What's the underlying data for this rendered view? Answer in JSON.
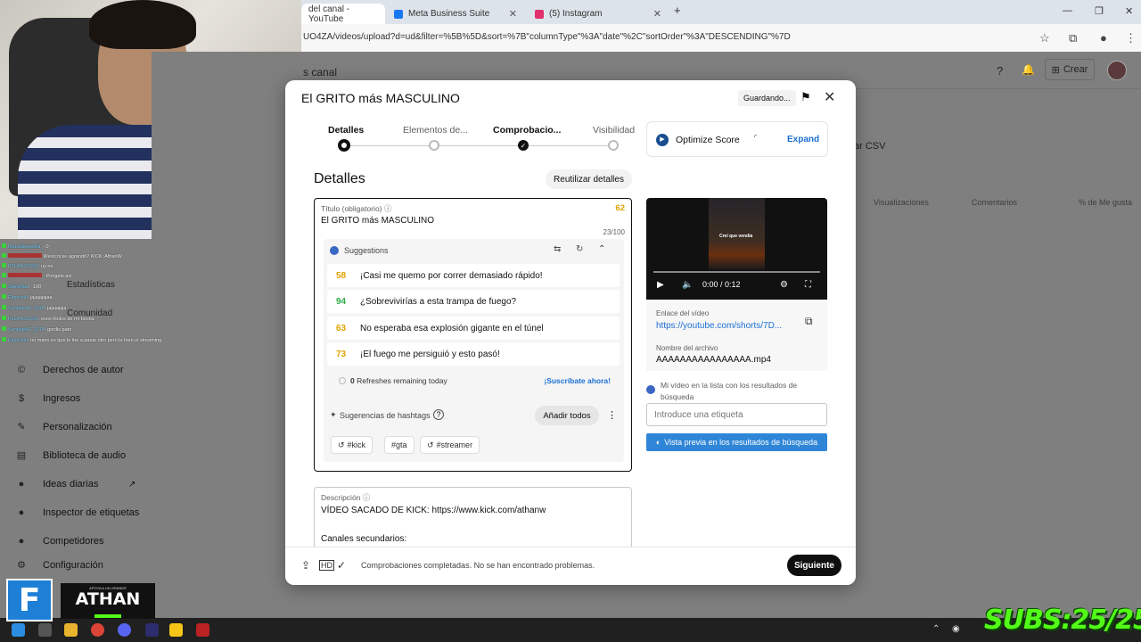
{
  "browser": {
    "tabs": [
      {
        "title": "del canal - YouTube",
        "color": "#ff0000"
      },
      {
        "title": "Meta Business Suite",
        "color": "#1877f2"
      },
      {
        "title": "(5) Instagram",
        "color": "#e1306c"
      }
    ],
    "url": "UO4ZA/videos/upload?d=ud&filter=%5B%5D&sort=%7B\"columnType\"%3A\"date\"%2C\"sortOrder\"%3A\"DESCENDING\"%7D"
  },
  "studio": {
    "title": "s canal",
    "crear": "Crear",
    "csv": "ar CSV",
    "columns": [
      "Visualizaciones",
      "Comentarios",
      "% de Me gusta"
    ],
    "sidebar": [
      {
        "icon": "©",
        "label": "Derechos de autor"
      },
      {
        "icon": "$",
        "label": "Ingresos"
      },
      {
        "icon": "✎",
        "label": "Personalización"
      },
      {
        "icon": "▤",
        "label": "Biblioteca de audio"
      },
      {
        "icon": "●",
        "label": "Ideas diarias"
      },
      {
        "icon": "●",
        "label": "Inspector de etiquetas"
      },
      {
        "icon": "●",
        "label": "Competidores"
      },
      {
        "icon": "⚙",
        "label": "Configuración"
      }
    ],
    "hidden_items": [
      "Estadísticas",
      "Comunidad"
    ]
  },
  "chat": [
    {
      "user": "Mariaalejandra_",
      "msg": ": 0"
    },
    {
      "user": "",
      "msg": "Westcol se agrandó? KICK: AthanW"
    },
    {
      "user": "P3LANGOSO",
      "msg": ": uy no"
    },
    {
      "user": "",
      "msg": ": Pongale así"
    },
    {
      "user": "SitesMad",
      "msg": ": -100"
    },
    {
      "user": "Elgordo6",
      "msg": ": jajajajajaa"
    },
    {
      "user": "SantiagoR_1974",
      "msg": ": jajajajaja"
    },
    {
      "user": "P3LANGOSO",
      "msg": ": esos títulos de mr bestia"
    },
    {
      "user": "SantiagoR_1974",
      "msg": ": gordis pato"
    },
    {
      "user": "Elgordo6",
      "msg": ": no mano es que le iba a pasar otro pero le tiran el streaming"
    }
  ],
  "modal": {
    "title": "El GRITO más MASCULINO",
    "saving": "Guardando...",
    "steps": [
      "Detalles",
      "Elementos de...",
      "Comprobacio...",
      "Visibilidad"
    ],
    "optimize": {
      "label": "Optimize Score",
      "expand": "Expand"
    },
    "details_heading": "Detalles",
    "reuse_button": "Reutilizar detalles",
    "title_field": {
      "label": "Título (obligatorio)",
      "score": "62",
      "value": "El GRITO más MASCULINO",
      "count": "23/100"
    },
    "suggestions": {
      "header": "Suggestions",
      "items": [
        {
          "score": "58",
          "color": "#e0a200",
          "text": "¡Casi me quemo por correr demasiado rápido!"
        },
        {
          "score": "94",
          "color": "#2eaa4a",
          "text": "¿Sobrevivirías a esta trampa de fuego?"
        },
        {
          "score": "63",
          "color": "#e0a200",
          "text": "No esperaba esa explosión gigante en el túnel"
        },
        {
          "score": "73",
          "color": "#e0a200",
          "text": "¡El fuego me persiguió y esto pasó!"
        }
      ],
      "refreshes": "0",
      "refreshes_text": "Refreshes remaining today",
      "subscribe": "¡Suscríbate ahora!"
    },
    "hashtags": {
      "label": "Sugerencias de hashtags",
      "add_all": "Añadir todos",
      "chips": [
        "#kick",
        "#gta",
        "#streamer"
      ]
    },
    "description": {
      "label": "Descripción",
      "line1": "VÍDEO SACADO DE KICK:  https://www.kick.com/athanw",
      "line2": "Canales secundarios:"
    },
    "video": {
      "caption": "Creí que vendía",
      "time": "0:00 / 0:12",
      "link_label": "Enlace del vídeo",
      "link": "https://youtube.com/shorts/7D...",
      "file_label": "Nombre del archivo",
      "file": "AAAAAAAAAAAAAAAA.mp4"
    },
    "listed_text": "Mi vídeo en la lista con los resultados de búsqueda",
    "tag_placeholder": "Introduce una etiqueta",
    "preview_button": "Vista previa en los resultados de búsqueda",
    "footer_text": "Comprobaciones completadas. No se han encontrado problemas.",
    "next_button": "Siguiente"
  },
  "overlay": {
    "f_logo": "F",
    "athan_small": "APOYA A UN GRANDE",
    "athan_name": "ATHAN",
    "subs": "SUBS:25/25"
  }
}
